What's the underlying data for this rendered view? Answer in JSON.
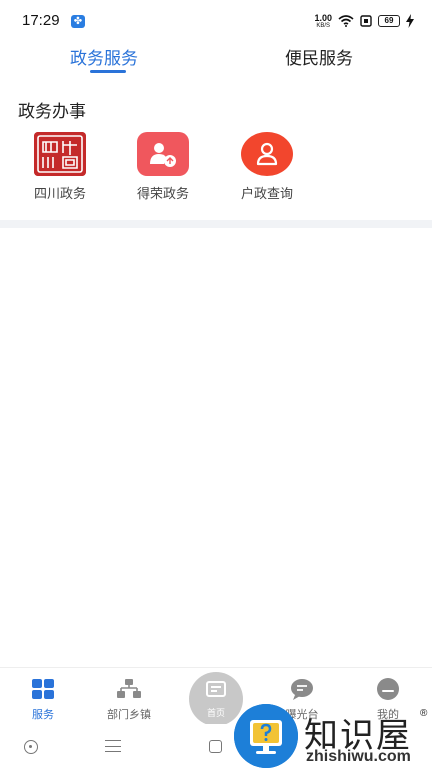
{
  "status_bar": {
    "time": "17:29",
    "app_badge": "✤",
    "net_speed_value": "1.00",
    "net_speed_unit": "KB/S",
    "battery": "69"
  },
  "tabs": [
    {
      "label": "政务服务",
      "active": true
    },
    {
      "label": "便民服务",
      "active": false
    }
  ],
  "section": {
    "title": "政务办事",
    "items": [
      {
        "label": "四川政务",
        "icon": "sichuan-seal-icon"
      },
      {
        "label": "得荣政务",
        "icon": "person-badge-icon"
      },
      {
        "label": "户政查询",
        "icon": "person-icon"
      }
    ]
  },
  "bottom_nav": {
    "items": [
      {
        "label": "服务",
        "icon": "grid-icon",
        "active": true
      },
      {
        "label": "部门乡镇",
        "icon": "org-chart-icon",
        "active": false
      },
      {
        "label": "首页",
        "icon": "home-icon",
        "active": false
      },
      {
        "label": "曝光台",
        "icon": "chat-icon",
        "active": false
      },
      {
        "label": "我的",
        "icon": "user-icon",
        "active": false
      }
    ]
  },
  "watermark": {
    "text": "知识屋",
    "domain": "zhishiwu.com",
    "reg": "®"
  },
  "colors": {
    "accent": "#2a73d9",
    "seal_red": "#c42a2a",
    "derong_red": "#f0575d",
    "huzheng_red": "#f2462d"
  }
}
